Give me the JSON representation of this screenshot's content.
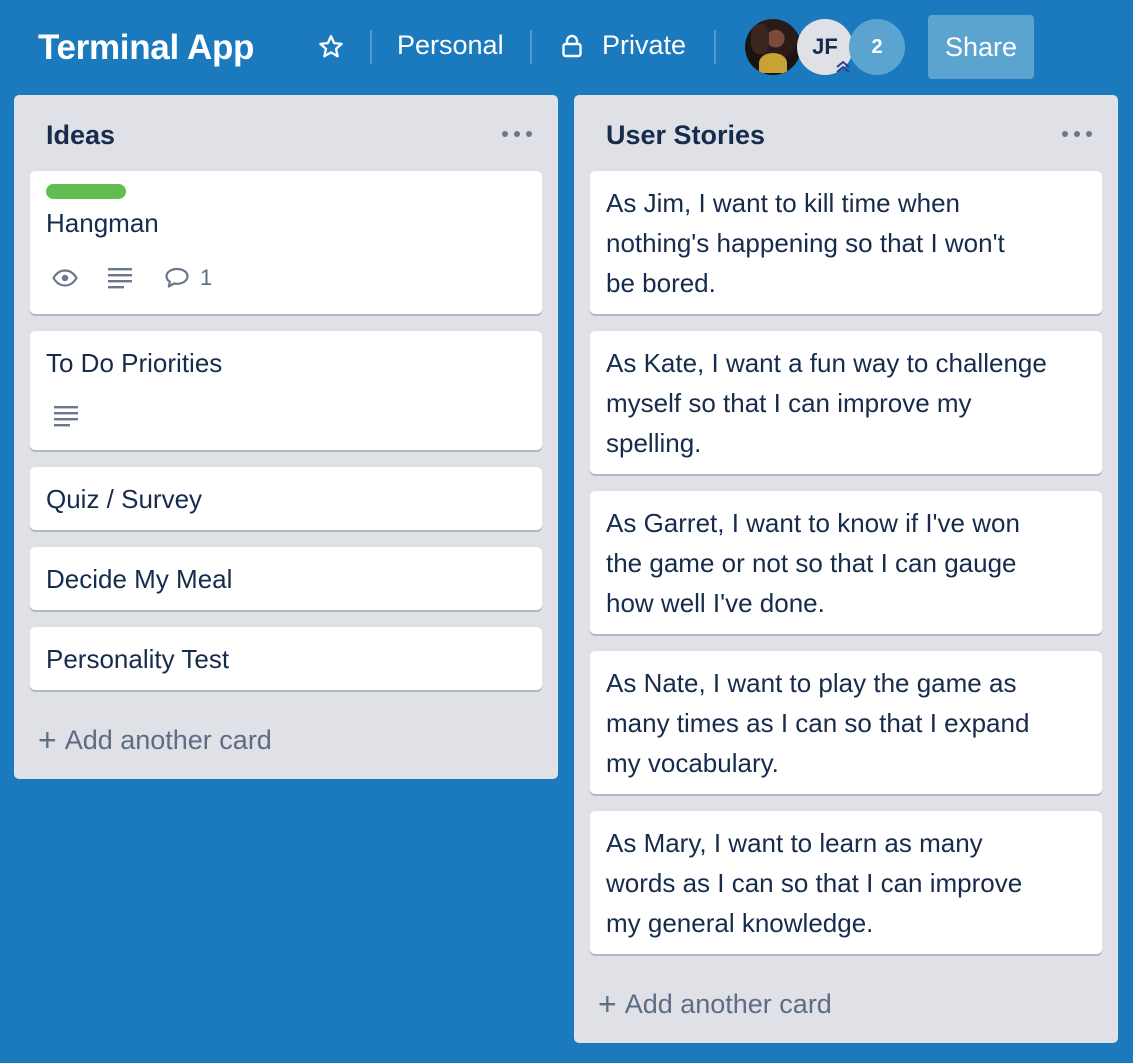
{
  "header": {
    "board_title": "Terminal App",
    "team_label": "Personal",
    "visibility_label": "Private",
    "member_initials": "JF",
    "extra_members": "2",
    "share_label": "Share"
  },
  "lists": [
    {
      "title": "Ideas",
      "add_card_label": "Add another card",
      "cards": [
        {
          "text": "Hangman",
          "label_color": "#61bd4f",
          "badges": {
            "watching": true,
            "description": true,
            "comments": "1"
          }
        },
        {
          "text": "To Do Priorities",
          "badges": {
            "description": true
          }
        },
        {
          "text": "Quiz / Survey"
        },
        {
          "text": "Decide My Meal"
        },
        {
          "text": "Personality Test"
        }
      ]
    },
    {
      "title": "User Stories",
      "add_card_label": "Add another card",
      "cards": [
        {
          "lines": [
            "As Jim, I want to kill time when",
            "nothing's happening so that I won't",
            "be bored."
          ]
        },
        {
          "lines": [
            "As Kate, I want a fun way to challenge",
            "myself so that I can improve my",
            "spelling."
          ]
        },
        {
          "lines": [
            "As Garret, I want to know if I've won",
            "the game or not so that I can gauge",
            "how well I've done."
          ]
        },
        {
          "lines": [
            "As Nate, I want to play the game as",
            "many times as I can so that I expand",
            "my vocabulary."
          ]
        },
        {
          "lines": [
            "As Mary, I want to learn as many",
            "words as I can so that I can improve",
            "my general knowledge."
          ]
        }
      ]
    }
  ],
  "colors": {
    "board_background": "#1b79be",
    "list_background": "#dfe1e6",
    "button_background": "#5ba4cf",
    "label_green": "#61bd4f",
    "text": "#172b4d"
  },
  "icons": [
    "star-icon",
    "lock-icon",
    "admin-chevron-icon",
    "list-menu-icon",
    "eye-icon",
    "description-icon",
    "comment-icon",
    "plus-icon"
  ]
}
